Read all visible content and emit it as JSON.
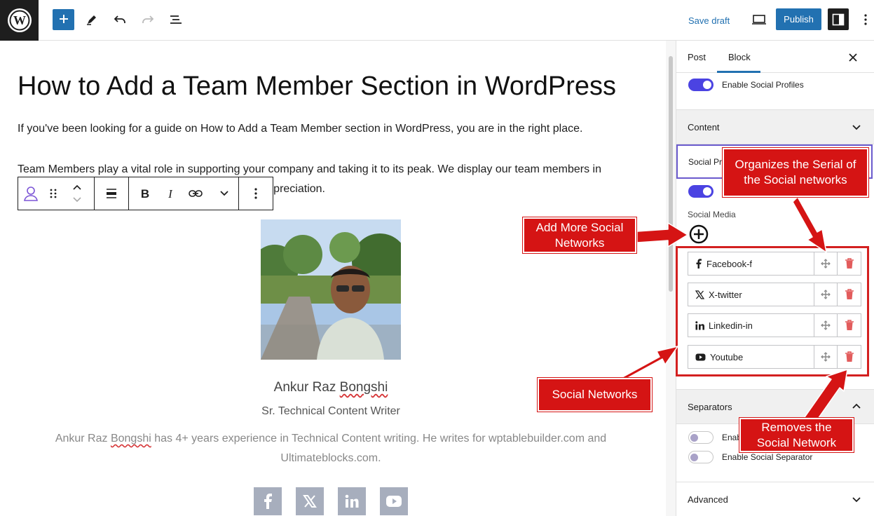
{
  "toolbar": {
    "save_draft": "Save draft",
    "publish": "Publish"
  },
  "post": {
    "title": "How to Add a Team Member Section in WordPress",
    "para1": "If you've been looking for a guide on How to Add a Team Member section in WordPress, you are in the right place.",
    "para2_line1": "Team Members play a vital role in supporting your company and taking it to its peak. We display our team members in",
    "para2_line2_visible": "edit and appreciation."
  },
  "member": {
    "name_first": "Ankur Raz ",
    "name_last": "Bongshi",
    "role": "Sr. Technical Content Writer",
    "bio_a": "Ankur Raz ",
    "bio_b": "Bongshi",
    "bio_c": " has 4+ years experience in Technical Content writing. He writes for wptablebuilder.com and",
    "bio_line2": "Ultimateblocks.com.",
    "social_icons": [
      "facebook-icon",
      "x-twitter-icon",
      "linkedin-icon",
      "youtube-icon"
    ],
    "icon_color": "#a7aebd"
  },
  "sidebar": {
    "tab_post": "Post",
    "tab_block": "Block",
    "enable_social_profiles": "Enable Social Profiles",
    "content_label": "Content",
    "social_profiles_label": "Social Pr",
    "social_media_label": "Social Media",
    "networks": [
      {
        "name": "Facebook-f",
        "icon": "facebook-f-icon"
      },
      {
        "name": "X-twitter",
        "icon": "x-twitter-icon"
      },
      {
        "name": "Linkedin-in",
        "icon": "linkedin-in-icon"
      },
      {
        "name": "Youtube",
        "icon": "youtube-icon"
      }
    ],
    "separators_label": "Separators",
    "separator_opt1": "Enab",
    "separator_opt2": "Enable Social Separator",
    "advanced_label": "Advanced",
    "toggle_color": "#4b43e2"
  },
  "callouts": {
    "add_more_line1": "Add More Social",
    "add_more_line2": "Networks",
    "organizes_line1": "Organizes the Serial of",
    "organizes_line2": "the Social networks",
    "social_networks": "Social Networks",
    "removes_line1": "Removes the",
    "removes_line2": "Social Network",
    "color": "#d51414"
  }
}
